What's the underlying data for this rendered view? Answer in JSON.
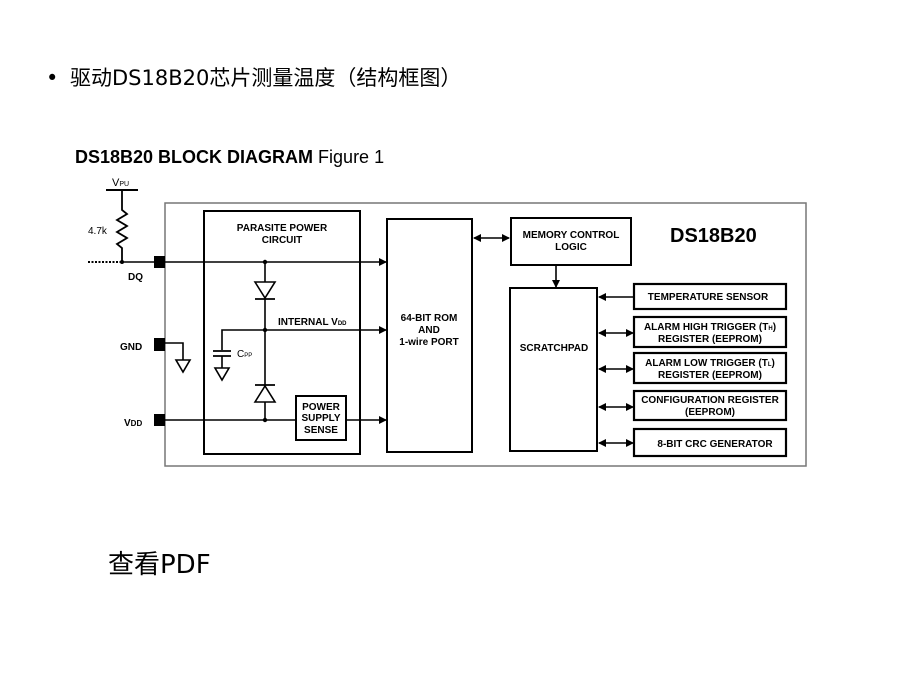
{
  "slide": {
    "bullet_symbol": "•",
    "bullet_text": "驱动DS18B20芯片测量温度（结构框图）",
    "link_text": "查看PDF"
  },
  "diagram": {
    "title_bold": "DS18B20 BLOCK DIAGRAM",
    "title_rest": "Figure 1",
    "chip_name": "DS18B20",
    "vpu": {
      "main": "V",
      "sub": "PU"
    },
    "resistor": "4.7k",
    "pins": {
      "dq": "DQ",
      "gnd": "GND",
      "vdd": {
        "main": "V",
        "sub": "DD"
      }
    },
    "parasite": {
      "line1": "PARASITE POWER",
      "line2": "CIRCUIT"
    },
    "internal_vdd": {
      "main": "INTERNAL V",
      "sub": "DD"
    },
    "cpp": {
      "main": "C",
      "sub": "PP"
    },
    "power_sense": {
      "line1": "POWER",
      "line2": "SUPPLY",
      "line3": "SENSE"
    },
    "rom": {
      "line1": "64-BIT ROM",
      "line2": "AND",
      "line3": "1-wire PORT"
    },
    "memory_control": {
      "line1": "MEMORY CONTROL",
      "line2": "LOGIC"
    },
    "scratchpad": "SCRATCHPAD",
    "temperature_sensor": "TEMPERATURE SENSOR",
    "alarm_high": {
      "line1a": "ALARM HIGH TRIGGER (T",
      "line1sub": "H",
      "line1b": ")",
      "line2": "REGISTER (EEPROM)"
    },
    "alarm_low": {
      "line1a": "ALARM LOW TRIGGER (T",
      "line1sub": "L",
      "line1b": ")",
      "line2": "REGISTER (EEPROM)"
    },
    "config": {
      "line1": "CONFIGURATION REGISTER",
      "line2": "(EEPROM)"
    },
    "crc": "8-BIT CRC GENERATOR"
  }
}
